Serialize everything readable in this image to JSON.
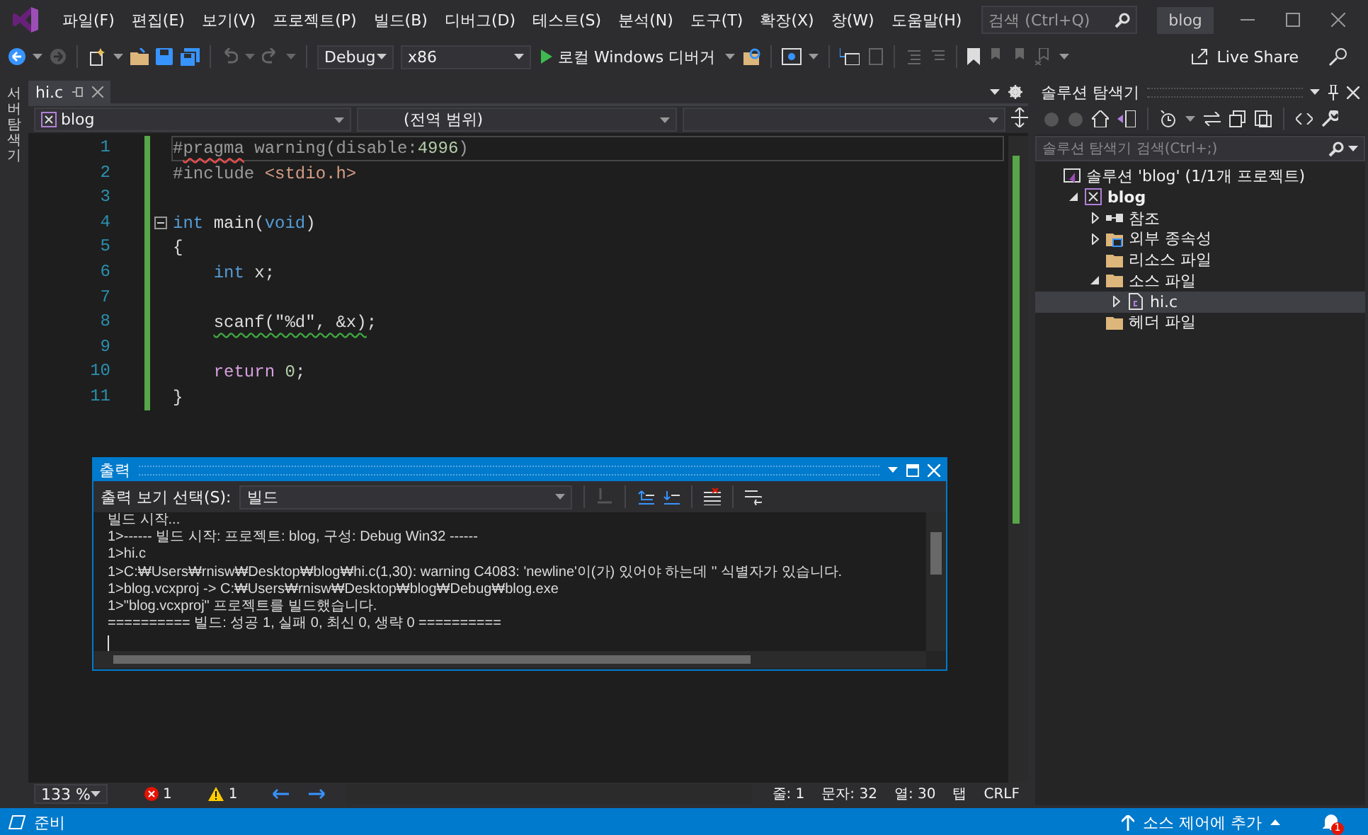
{
  "title_bar": {
    "menu": [
      "파일(F)",
      "편집(E)",
      "보기(V)",
      "프로젝트(P)",
      "빌드(B)",
      "디버그(D)",
      "테스트(S)",
      "분석(N)",
      "도구(T)",
      "확장(X)",
      "창(W)",
      "도움말(H)"
    ],
    "search": {
      "placeholder": "검색 (Ctrl+Q)"
    },
    "solution_name": "blog"
  },
  "toolbar": {
    "configuration": "Debug",
    "platform": "x86",
    "run_button": "로컬 Windows 디버거",
    "live_share": "Live Share"
  },
  "side_tab": "서버 탐색기",
  "editor": {
    "tabs": [
      {
        "label": "hi.c",
        "selected": true
      }
    ],
    "nav_bar": [
      "blog",
      "(전역 범위)"
    ],
    "lines": [
      {
        "number": "1",
        "current": true,
        "fold": false,
        "tokens": [
          {
            "kind": "preproc",
            "text": "#"
          },
          {
            "kind": "error",
            "text": "pragma"
          },
          {
            "kind": "preproc",
            "text": " warning(disable:"
          },
          {
            "kind": "number",
            "text": "4996"
          },
          {
            "kind": "preproc",
            "text": ")"
          }
        ]
      },
      {
        "number": "2",
        "current": false,
        "fold": false,
        "tokens": [
          {
            "kind": "preproc",
            "text": "#include"
          },
          {
            "kind": "string",
            "text": " <stdio.h>"
          }
        ]
      },
      {
        "number": "3",
        "current": false,
        "fold": false
      },
      {
        "number": "4",
        "current": false,
        "fold": true,
        "tokens": [
          {
            "kind": "keyword",
            "text": "int"
          },
          {
            "kind": "plain",
            "text": " main("
          },
          {
            "kind": "keyword",
            "text": "void"
          },
          {
            "kind": "plain",
            "text": ")"
          }
        ]
      },
      {
        "number": "5",
        "current": false,
        "fold": false,
        "tokens": [
          {
            "kind": "plain",
            "text": "{"
          }
        ]
      },
      {
        "number": "6",
        "current": false,
        "fold": false,
        "tokens": [
          {
            "kind": "keyword",
            "text": "    int"
          },
          {
            "kind": "plain",
            "text": " x;"
          }
        ]
      },
      {
        "number": "7",
        "current": false,
        "fold": false
      },
      {
        "number": "8",
        "current": false,
        "fold": false,
        "tokens": [
          {
            "kind": "warning",
            "text": "    scanf(\"%d\", &x)"
          },
          {
            "kind": "plain",
            "text": ";"
          }
        ]
      },
      {
        "number": "9",
        "current": false,
        "fold": false
      },
      {
        "number": "10",
        "current": false,
        "fold": false,
        "tokens": [
          {
            "kind": "control",
            "text": "    return"
          },
          {
            "kind": "number",
            "text": " 0"
          },
          {
            "kind": "plain",
            "text": ";"
          }
        ]
      },
      {
        "number": "11",
        "current": false,
        "fold": false,
        "tokens": [
          {
            "kind": "plain",
            "text": "}"
          }
        ]
      }
    ],
    "status": {
      "zoom": "133 %",
      "errors": "1",
      "warnings": "1",
      "line": "줄: 1",
      "char": "문자: 32",
      "column": "열: 30",
      "indent": "탭",
      "line_ending": "CRLF"
    }
  },
  "output": {
    "title": "출력",
    "source_label": "출력 보기 선택(S):",
    "source": "빌드",
    "lines": [
      "빌드 시작...",
      "1>------ 빌드 시작: 프로젝트: blog, 구성: Debug Win32 ------",
      "1>hi.c",
      "1>C:₩Users₩rnisw₩Desktop₩blog₩hi.c(1,30): warning C4083: 'newline'이(가) 있어야 하는데 '' 식별자가 있습니다.",
      "1>blog.vcxproj -> C:₩Users₩rnisw₩Desktop₩blog₩Debug₩blog.exe",
      "1>\"blog.vcxproj\" 프로젝트를 빌드했습니다.",
      "========== 빌드: 성공 1, 실패 0, 최신 0, 생략 0 =========="
    ]
  },
  "solution_explorer": {
    "title": "솔루션 탐색기",
    "search": {
      "placeholder": "솔루션 탐색기 검색(Ctrl+;)"
    },
    "tree": [
      {
        "label": "솔루션 'blog' (1/1개 프로젝트)",
        "kind": "solution",
        "selected": false,
        "children": [
          {
            "label": "blog",
            "kind": "project",
            "selected": false,
            "expanded": true,
            "children": [
              {
                "label": "참조",
                "kind": "references",
                "selected": false,
                "expanded": false
              },
              {
                "label": "외부 종속성",
                "kind": "dependencies",
                "selected": false,
                "expanded": false
              },
              {
                "label": "리소스 파일",
                "kind": "folder",
                "selected": false
              },
              {
                "label": "소스 파일",
                "kind": "folder",
                "selected": false,
                "expanded": true,
                "children": [
                  {
                    "label": "hi.c",
                    "kind": "file",
                    "selected": true,
                    "expanded": false
                  }
                ]
              },
              {
                "label": "헤더 파일",
                "kind": "folder",
                "selected": false
              }
            ]
          }
        ]
      }
    ]
  },
  "status_bar": {
    "text": "준비",
    "source_control": "소스 제어에 추가",
    "notifications": "1"
  }
}
